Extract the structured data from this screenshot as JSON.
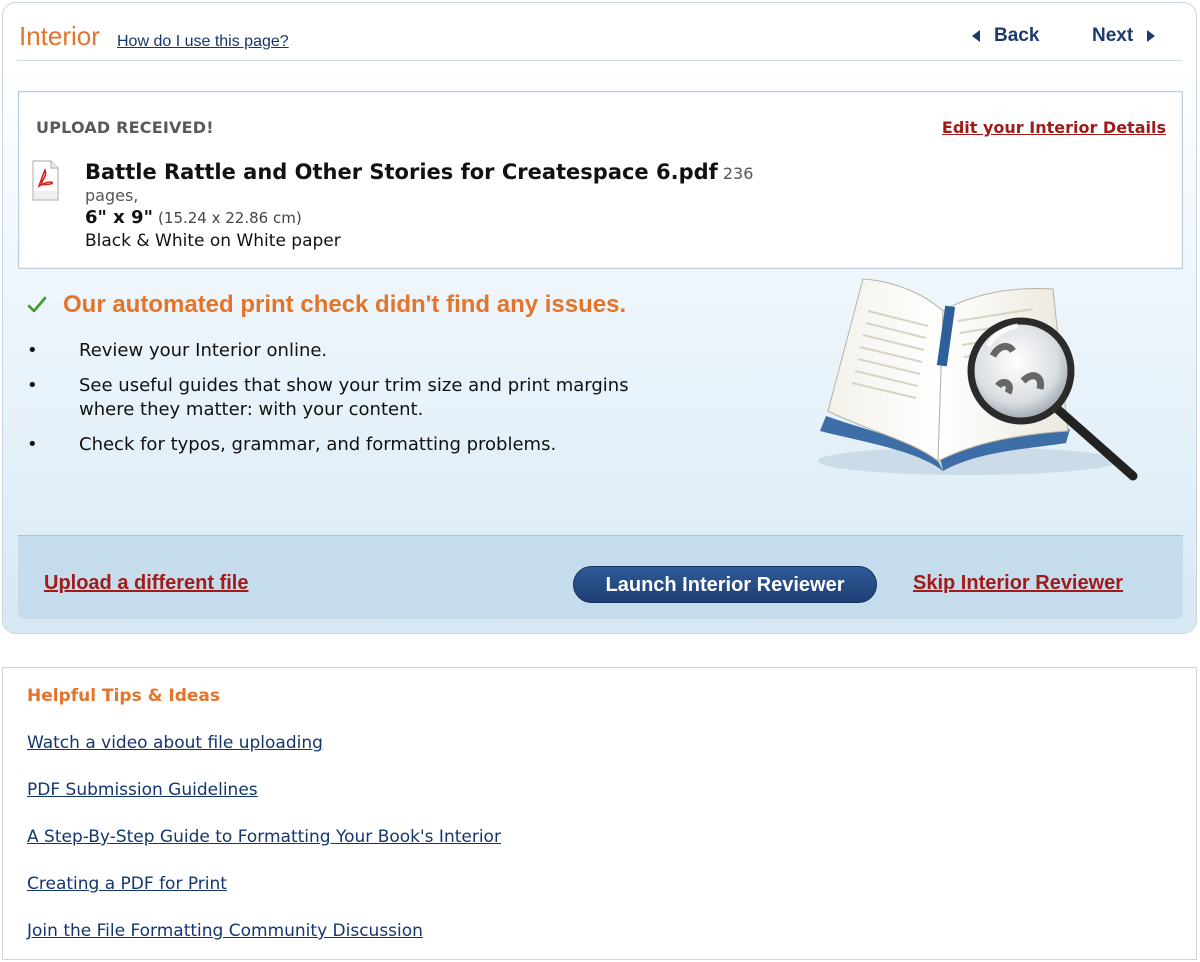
{
  "header": {
    "title": "Interior",
    "help_link": "How do I use this page?",
    "back_label": "Back",
    "next_label": "Next"
  },
  "upload": {
    "status": "UPLOAD RECEIVED!",
    "edit_link": "Edit your Interior Details",
    "file_icon": "pdf-file-icon",
    "file_name": "Battle Rattle and Other Stories for Createspace 6.pdf",
    "page_count": "236",
    "pages_suffix": "pages,",
    "trim_size": "6\" x 9\"",
    "trim_size_cm": "(15.24 x 22.86 cm)",
    "paper": "Black & White on White paper"
  },
  "check": {
    "icon": "checkmark-icon",
    "title": "Our automated print check didn't find any issues.",
    "bullets": [
      "Review your Interior online.",
      "See useful guides that show your trim size and print margins where they matter: with your content.",
      "Check for typos, grammar, and formatting problems."
    ]
  },
  "actions": {
    "upload_different": "Upload a different file",
    "launch_reviewer": "Launch Interior Reviewer",
    "skip_reviewer": "Skip Interior Reviewer"
  },
  "tips": {
    "title": "Helpful Tips & Ideas",
    "links": [
      "Watch a video about file uploading",
      "PDF Submission Guidelines",
      "A Step-By-Step Guide to Formatting Your Book's Interior",
      "Creating a PDF for Print",
      "Join the File Formatting Community Discussion"
    ]
  },
  "colors": {
    "accent_orange": "#e4742a",
    "link_red": "#a11b1b",
    "link_blue": "#14366f",
    "button_blue": "#1e3f73",
    "check_green": "#3a9a2a"
  }
}
